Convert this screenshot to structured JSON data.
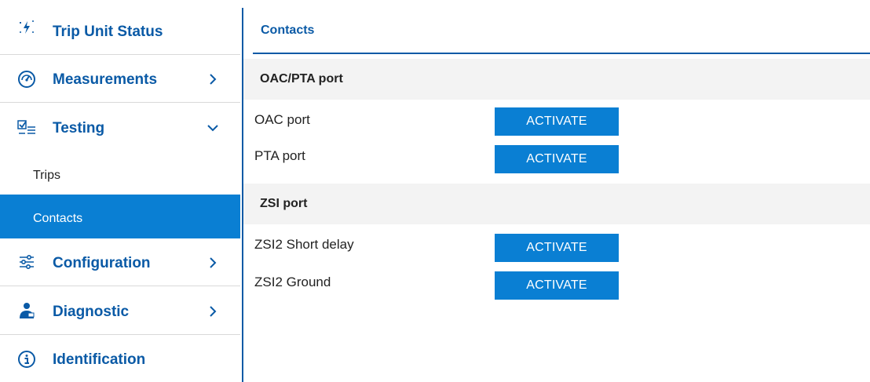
{
  "sidebar": {
    "items": [
      {
        "label": "Trip Unit Status",
        "icon": "lightning-icon"
      },
      {
        "label": "Measurements",
        "icon": "gauge-icon"
      },
      {
        "label": "Testing",
        "icon": "checklist-icon"
      },
      {
        "label": "Configuration",
        "icon": "sliders-icon"
      },
      {
        "label": "Diagnostic",
        "icon": "technician-icon"
      },
      {
        "label": "Identification",
        "icon": "info-icon"
      }
    ],
    "testing_sub": [
      {
        "label": "Trips"
      },
      {
        "label": "Contacts"
      }
    ]
  },
  "main": {
    "title": "Contacts",
    "sections": [
      {
        "title": "OAC/PTA port",
        "rows": [
          {
            "label": "OAC port",
            "button": "ACTIVATE"
          },
          {
            "label": "PTA port",
            "button": "ACTIVATE"
          }
        ]
      },
      {
        "title": "ZSI port",
        "rows": [
          {
            "label": "ZSI2 Short delay",
            "button": "ACTIVATE"
          },
          {
            "label": "ZSI2 Ground",
            "button": "ACTIVATE"
          }
        ]
      }
    ]
  },
  "colors": {
    "brand_blue": "#0a5aa6",
    "active_bg": "#0a7fd3",
    "button_bg": "#0a7fd3"
  }
}
